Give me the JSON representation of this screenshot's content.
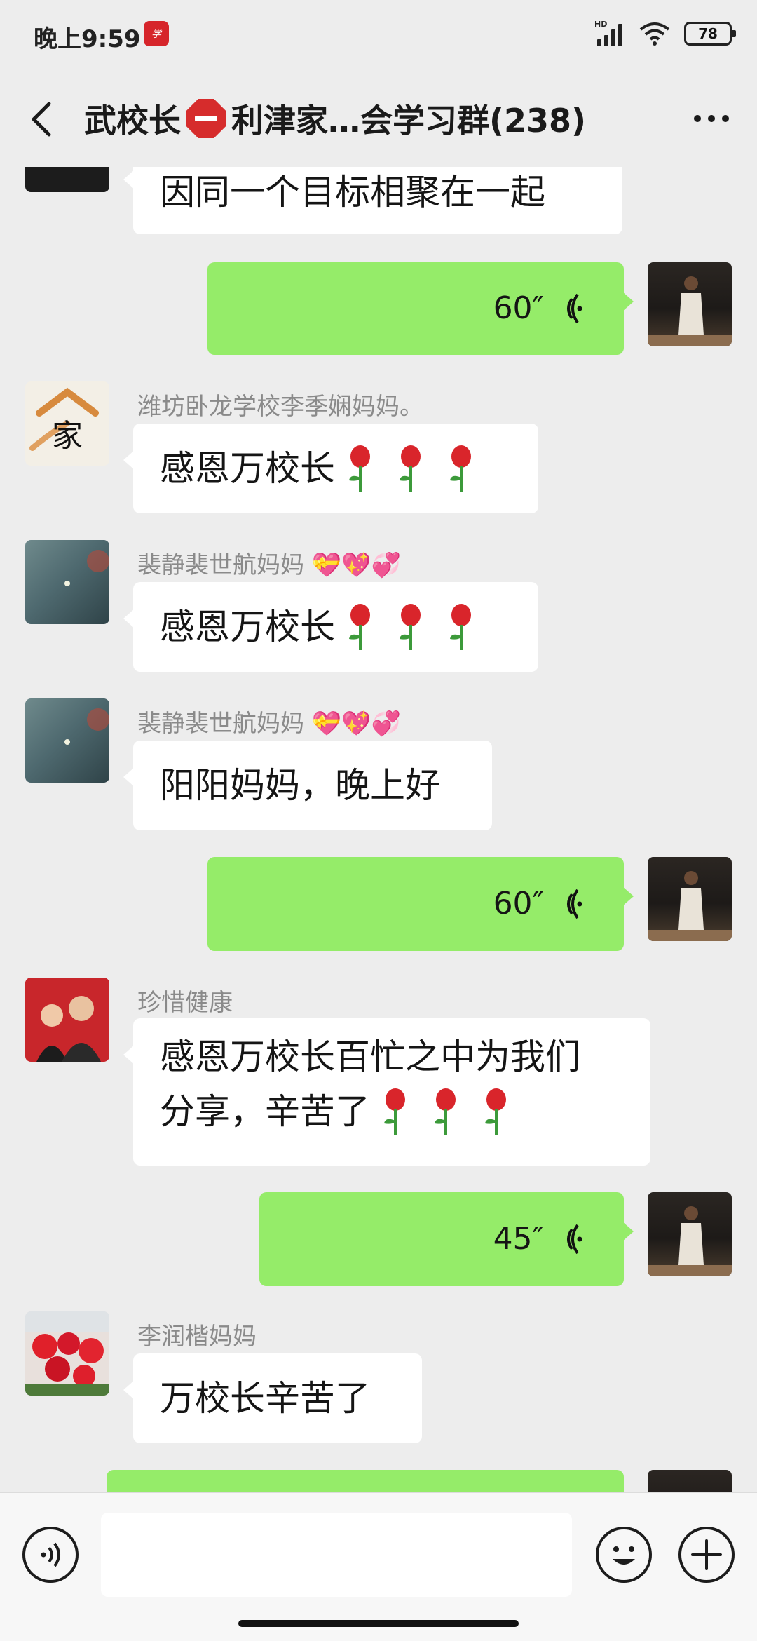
{
  "status": {
    "time": "晚上9:59",
    "network": "HD",
    "battery": "78"
  },
  "header": {
    "title_part1": "武校长",
    "title_part2": "利津家…会学习群(238)"
  },
  "messages": {
    "m0": {
      "text": "因同一个目标相聚在一起"
    },
    "m1": {
      "duration": "60″"
    },
    "m2": {
      "sender": "潍坊卧龙学校李季娴妈妈。",
      "text": "感恩万校长"
    },
    "m3": {
      "sender": "裴静裴世航妈妈",
      "text": "感恩万校长"
    },
    "m4": {
      "sender": "裴静裴世航妈妈",
      "text": "阳阳妈妈，晚上好"
    },
    "m5": {
      "duration": "60″"
    },
    "m6": {
      "sender": "珍惜健康",
      "line1": "感恩万校长百忙之中为我们",
      "line2": "分享，辛苦了"
    },
    "m7": {
      "duration": "45″"
    },
    "m8": {
      "sender": "李润楷妈妈",
      "text": "万校长辛苦了"
    }
  },
  "avatar_family_text": "家",
  "colors": {
    "background": "#ededed",
    "voice_bubble": "#95ec69",
    "text_bubble": "#ffffff",
    "sender_name": "#8a8a8a"
  },
  "icons": [
    "back-icon",
    "more-icon",
    "stop-sign-icon",
    "voice-wave-icon",
    "rose-icon",
    "heart-emoji-icon",
    "voice-input-icon",
    "emoji-icon",
    "plus-icon"
  ]
}
